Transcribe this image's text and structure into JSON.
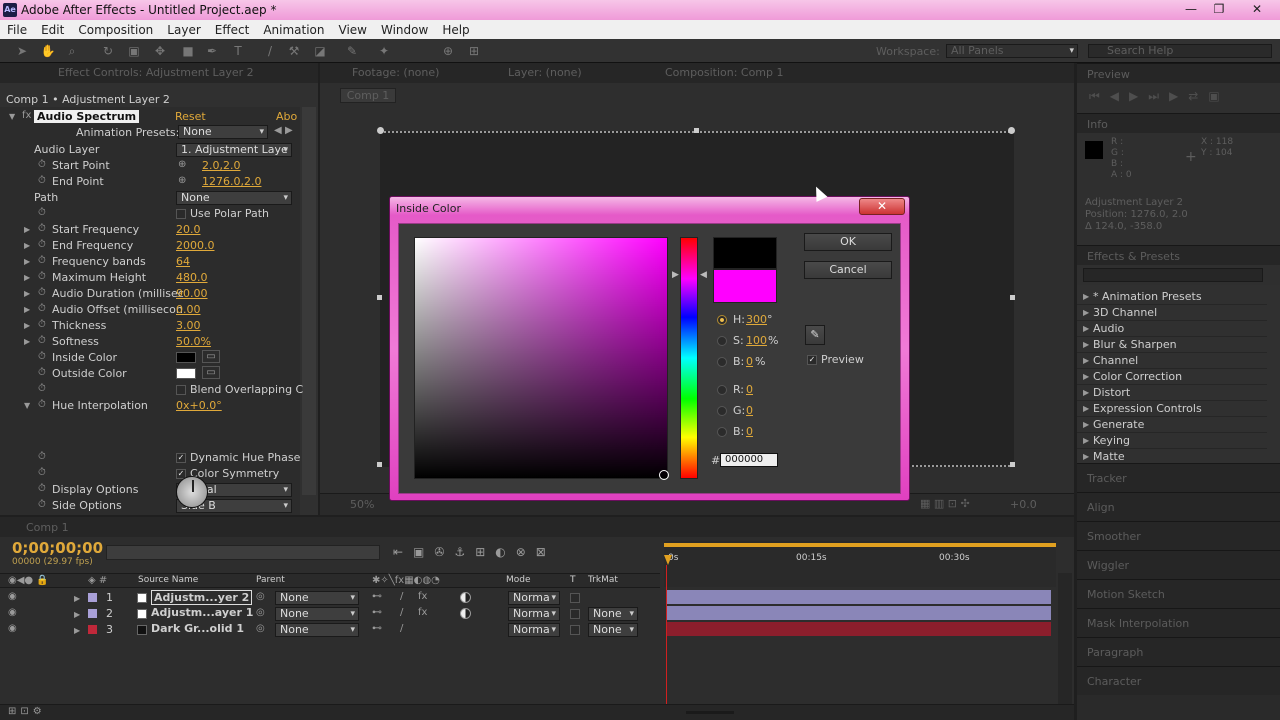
{
  "window": {
    "title": "Adobe After Effects - Untitled Project.aep *",
    "logo": "Ae"
  },
  "menu": [
    "File",
    "Edit",
    "Composition",
    "Layer",
    "Effect",
    "Animation",
    "View",
    "Window",
    "Help"
  ],
  "workspace": {
    "label": "Workspace:",
    "value": "All Panels",
    "search": "Search Help"
  },
  "fx_panel": {
    "tab": "Effect Controls: Adjustment Layer 2",
    "breadcrumb": "Comp 1 • Adjustment Layer 2",
    "effect_name": "Audio Spectrum",
    "reset": "Reset",
    "about": "Abo",
    "animation_presets_label": "Animation Presets:",
    "animation_presets_value": "None",
    "rows": [
      {
        "label": "Audio Layer",
        "dd": "1. Adjustment Laye"
      },
      {
        "label": "Start Point",
        "val": "2.0,2.0"
      },
      {
        "label": "End Point",
        "val": "1276.0,2.0"
      },
      {
        "label": "Path",
        "dd": "None"
      },
      {
        "label": "",
        "check": "Use Polar Path"
      },
      {
        "label": "Start Frequency",
        "val": "20.0"
      },
      {
        "label": "End Frequency",
        "val": "2000.0"
      },
      {
        "label": "Frequency bands",
        "val": "64"
      },
      {
        "label": "Maximum Height",
        "val": "480.0"
      },
      {
        "label": "Audio Duration (millisec",
        "val": "90.00"
      },
      {
        "label": "Audio Offset (millisecon",
        "val": "0.00"
      },
      {
        "label": "Thickness",
        "val": "3.00"
      },
      {
        "label": "Softness",
        "val": "50.0%"
      },
      {
        "label": "Inside Color"
      },
      {
        "label": "Outside Color"
      },
      {
        "label": "",
        "check": "Blend Overlapping C"
      },
      {
        "label": "Hue Interpolation",
        "val": "0x+0.0°"
      },
      {
        "label": "",
        "check": "Dynamic Hue Phase"
      },
      {
        "label": "",
        "check": "Color Symmetry"
      },
      {
        "label": "Display Options",
        "dd": "Digital"
      },
      {
        "label": "Side Options",
        "dd": "Side B"
      }
    ]
  },
  "comp_panel": {
    "tabs": [
      "Footage: (none)",
      "Layer: (none)",
      "Composition: Comp 1"
    ],
    "sub_tab": "Comp 1",
    "zoom": "50%",
    "offset": "+0.0"
  },
  "dialog": {
    "title": "Inside Color",
    "ok": "OK",
    "cancel": "Cancel",
    "preview": "Preview",
    "h_label": "H:",
    "h_value": "300",
    "h_unit": "°",
    "s_label": "S:",
    "s_value": "100",
    "s_unit": "%",
    "b_label": "B:",
    "b_value": "0",
    "b_unit": "%",
    "r_label": "R:",
    "r_value": "0",
    "g_label": "G:",
    "g_value": "0",
    "b2_label": "B:",
    "b2_value": "0",
    "hex_label": "#",
    "hex_value": "000000",
    "new_color": "#000000",
    "old_color": "#ff00ff"
  },
  "right": {
    "preview": "Preview",
    "info": "Info",
    "info_values": {
      "r": "R :",
      "g": "G :",
      "b": "B :",
      "a": "A : 0",
      "x": "X : 118",
      "y": "Y : 104"
    },
    "info_layer": "Adjustment Layer 2",
    "info_pos": "Position: 1276.0, 2.0",
    "info_delta": "Δ 124.0, -358.0",
    "effects_title": "Effects & Presets",
    "effects": [
      "* Animation Presets",
      "3D Channel",
      "Audio",
      "Blur & Sharpen",
      "Channel",
      "Color Correction",
      "Distort",
      "Expression Controls",
      "Generate",
      "Keying",
      "Matte",
      "Noise & Grain"
    ],
    "panels": [
      "Tracker",
      "Align",
      "Smoother",
      "Wiggler",
      "Motion Sketch",
      "Mask Interpolation",
      "Paragraph",
      "Character"
    ]
  },
  "timeline": {
    "tab": "Comp 1",
    "timecode": "0;00;00;00",
    "fps": "00000 (29.97 fps)",
    "headers": {
      "source": "Source Name",
      "parent": "Parent",
      "mode": "Mode",
      "t": "T",
      "trkmat": "TrkMat"
    },
    "ruler": [
      "0s",
      "00:15s",
      "00:30s"
    ],
    "layers": [
      {
        "num": "1",
        "name": "Adjustm...yer 2",
        "parent": "None",
        "mode": "Norma",
        "trk": "",
        "color": "#a9a0d8"
      },
      {
        "num": "2",
        "name": "Adjustm...ayer 1",
        "parent": "None",
        "mode": "Norma",
        "trk": "None",
        "color": "#a9a0d8"
      },
      {
        "num": "3",
        "name": "Dark Gr...olid 1",
        "parent": "None",
        "mode": "Norma",
        "trk": "None",
        "color": "#c0283a"
      }
    ]
  }
}
